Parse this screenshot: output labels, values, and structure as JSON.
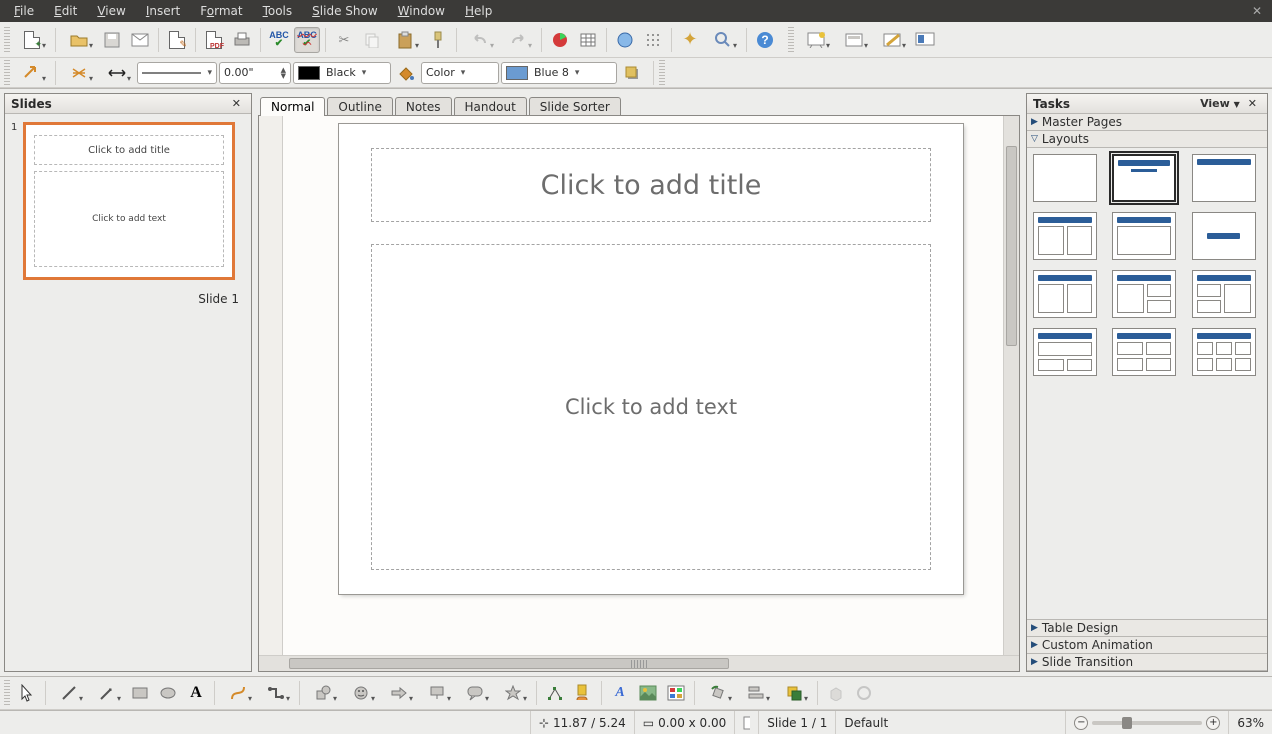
{
  "menubar": {
    "items": [
      "File",
      "Edit",
      "View",
      "Insert",
      "Format",
      "Tools",
      "Slide Show",
      "Window",
      "Help"
    ]
  },
  "toolbar2": {
    "line_width": "0.00\"",
    "line_color_label": "Black",
    "fill_mode": "Color",
    "fill_color_label": "Blue 8",
    "fill_swatch": "#6b9bd1",
    "black_swatch": "#000000"
  },
  "slides_panel": {
    "title": "Slides",
    "slide_number": "1",
    "thumb_title": "Click to add title",
    "thumb_body": "Click to add text",
    "slide_label": "Slide 1"
  },
  "view_tabs": [
    "Normal",
    "Outline",
    "Notes",
    "Handout",
    "Slide Sorter"
  ],
  "active_view_tab": 0,
  "canvas": {
    "title_placeholder": "Click to add title",
    "body_placeholder": "Click to add text"
  },
  "tasks_panel": {
    "title": "Tasks",
    "view_label": "View",
    "sections": {
      "master_pages": "Master Pages",
      "layouts": "Layouts",
      "table_design": "Table Design",
      "custom_animation": "Custom Animation",
      "slide_transition": "Slide Transition"
    },
    "selected_layout_index": 1
  },
  "statusbar": {
    "position": "11.87 / 5.24",
    "size": "0.00 x 0.00",
    "slide_info": "Slide 1 / 1",
    "page_style": "Default",
    "zoom_percent": "63%"
  }
}
